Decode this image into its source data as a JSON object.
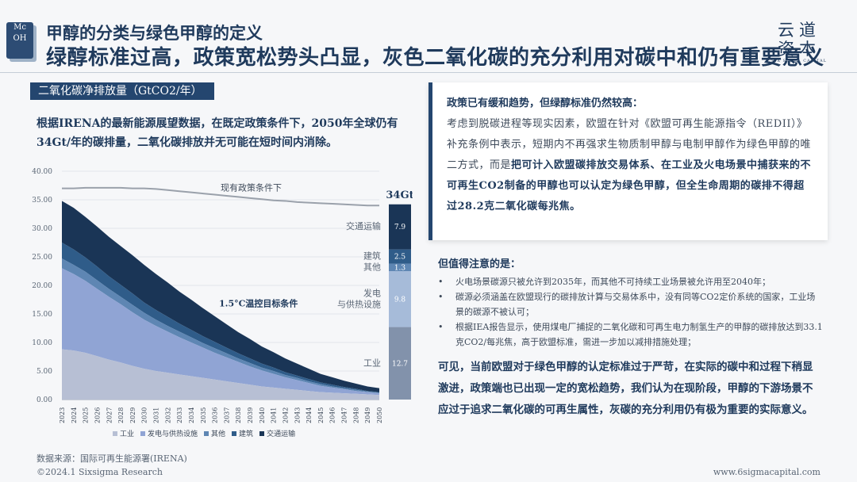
{
  "header": {
    "logo_line1": "Mc",
    "logo_line2": "OH",
    "title": "甲醇的分类与绿色甲醇的定义",
    "subtitle": "绿醇标准过高，政策宽松势头凸显，灰色二氧化碳的充分利用对碳中和仍有重要意义",
    "brand_line1": "云道",
    "brand_line2": "资本",
    "brand_line3": "SIX SIGMA CAPITAL"
  },
  "left": {
    "section_label": "二氧化碳净排放量（GtCO2/年）",
    "lead_text": "根据IRENA的最新能源展望数据，在既定政策条件下，2050年全球仍有34Gt/年的碳排量，二氧化碳排放并无可能在短时间内消除。",
    "source": "数据来源：国际可再生能源署(IRENA)"
  },
  "chart_data": {
    "type": "area",
    "title": "二氧化碳净排放量（GtCO2/年）",
    "x": [
      "2023",
      "2024",
      "2025",
      "2026",
      "2027",
      "2028",
      "2029",
      "2030",
      "2031",
      "2032",
      "2033",
      "2034",
      "2035",
      "2036",
      "2037",
      "2038",
      "2039",
      "2040",
      "2041",
      "2042",
      "2043",
      "2044",
      "2045",
      "2046",
      "2047",
      "2048",
      "2049",
      "2050"
    ],
    "ylim": [
      0,
      40
    ],
    "yticks": [
      "0.00",
      "5.00",
      "10.00",
      "15.00",
      "20.00",
      "25.00",
      "30.00",
      "35.00",
      "40.00"
    ],
    "stacked": true,
    "series": [
      {
        "name": "工业",
        "color": "#b7bfd4",
        "values": [
          8.8,
          8.6,
          8.2,
          7.6,
          7.0,
          6.5,
          5.9,
          5.4,
          5.0,
          4.7,
          4.4,
          4.1,
          3.8,
          3.5,
          3.2,
          2.9,
          2.6,
          2.3,
          2.1,
          1.9,
          1.7,
          1.5,
          1.3,
          1.2,
          1.1,
          1.0,
          0.9,
          0.8
        ]
      },
      {
        "name": "发电与供热设施",
        "color": "#90a4d4",
        "values": [
          14.2,
          13.4,
          12.6,
          11.8,
          11.0,
          10.2,
          9.4,
          8.6,
          7.9,
          7.2,
          6.5,
          5.9,
          5.3,
          4.7,
          4.2,
          3.7,
          3.2,
          2.8,
          2.4,
          2.0,
          1.7,
          1.4,
          1.1,
          0.9,
          0.7,
          0.5,
          0.4,
          0.3
        ]
      },
      {
        "name": "其他",
        "color": "#5e86b3",
        "values": [
          1.7,
          1.6,
          1.6,
          1.5,
          1.4,
          1.3,
          1.3,
          1.2,
          1.1,
          1.0,
          1.0,
          0.9,
          0.8,
          0.8,
          0.7,
          0.6,
          0.6,
          0.5,
          0.5,
          0.4,
          0.4,
          0.3,
          0.3,
          0.2,
          0.2,
          0.2,
          0.1,
          0.1
        ]
      },
      {
        "name": "建筑",
        "color": "#2f5c89",
        "values": [
          2.8,
          2.7,
          2.5,
          2.4,
          2.2,
          2.1,
          2.0,
          1.8,
          1.7,
          1.6,
          1.4,
          1.3,
          1.2,
          1.1,
          1.0,
          0.9,
          0.8,
          0.7,
          0.6,
          0.5,
          0.4,
          0.4,
          0.3,
          0.3,
          0.2,
          0.2,
          0.1,
          0.1
        ]
      },
      {
        "name": "交通运输",
        "color": "#1a3556",
        "values": [
          7.3,
          7.3,
          7.1,
          7.0,
          6.9,
          6.8,
          6.7,
          6.6,
          6.3,
          6.0,
          5.6,
          5.3,
          4.9,
          4.5,
          4.1,
          3.7,
          3.4,
          3.0,
          2.7,
          2.4,
          2.1,
          1.8,
          1.5,
          1.3,
          1.1,
          0.9,
          0.8,
          0.7
        ]
      }
    ],
    "policy_line": {
      "name": "现有政策条件下",
      "values": [
        37.0,
        37.0,
        37.1,
        37.1,
        37.1,
        37.1,
        37.0,
        37.0,
        36.9,
        36.7,
        36.5,
        36.3,
        36.1,
        35.9,
        35.7,
        35.5,
        35.3,
        35.1,
        34.9,
        34.8,
        34.6,
        34.5,
        34.4,
        34.3,
        34.2,
        34.1,
        34.0,
        34.0
      ]
    },
    "target_label": "1.5°C温控目标条件",
    "bar_2050": {
      "total_label": "34Gt",
      "segments": [
        {
          "name": "工业",
          "label": "工业",
          "value": 12.7,
          "color": "#8292ab"
        },
        {
          "name": "发电与供热设施",
          "label": "发电\n与供热设施",
          "value": 9.8,
          "color": "#a6bbd9"
        },
        {
          "name": "其他",
          "label": "其他",
          "value": 1.3,
          "color": "#5e86b3"
        },
        {
          "name": "建筑",
          "label": "建筑",
          "value": 2.5,
          "color": "#2f5c89"
        },
        {
          "name": "交通运输",
          "label": "交通运输",
          "value": 7.9,
          "color": "#1a3556"
        }
      ]
    },
    "legend": [
      "工业",
      "发电与供热设施",
      "其他",
      "建筑",
      "交通运输"
    ]
  },
  "right": {
    "box_head": "政策已有缓和趋势，但绿醇标准仍然较高：",
    "box_body_plain": "考虑到脱碳进程等现实因素，欧盟在针对《欧盟可再生能源指令（REDII）》补充条例中表示，短期内不再强求生物质制甲醇与电制甲醇作为绿色甲醇的唯二方式，而是",
    "box_body_bold": "把可计入欧盟碳排放交易体系、在工业及火电场景中捕获来的不可再生CO2制备的甲醇也可以认定为绿色甲醇，但全生命周期的碳排不得超过28.2克二氧化碳每兆焦。",
    "attention_title": "但值得注意的是：",
    "bullets": [
      "火电场景碳源只被允许到2035年，而其他不可持续工业场景被允许用至2040年；",
      "碳源必须涵盖在欧盟现行的碳排放计算与交易体系中，没有同等CO2定价系统的国家，工业场景的碳源不被认可；",
      "根据IEA报告显示，使用煤电厂捕捉的二氧化碳和可再生电力制氢生产的甲醇的碳排放达到33.1克CO2/每兆焦，高于欧盟标准，需进一步加以减排措施处理；"
    ],
    "conclusion": "可见，当前欧盟对于绿色甲醇的认定标准过于严苛，在实际的碳中和过程下稍显激进，政策端也已出现一定的宽松趋势，我们认为在现阶段，甲醇的下游场景不应过于追求二氧化碳的可再生属性，灰碳的充分利用仍有极为重要的实际意义。"
  },
  "footer": {
    "copyright": "©2024.1 Sixsigma Research",
    "url": "www.6sigmacapital.com"
  }
}
